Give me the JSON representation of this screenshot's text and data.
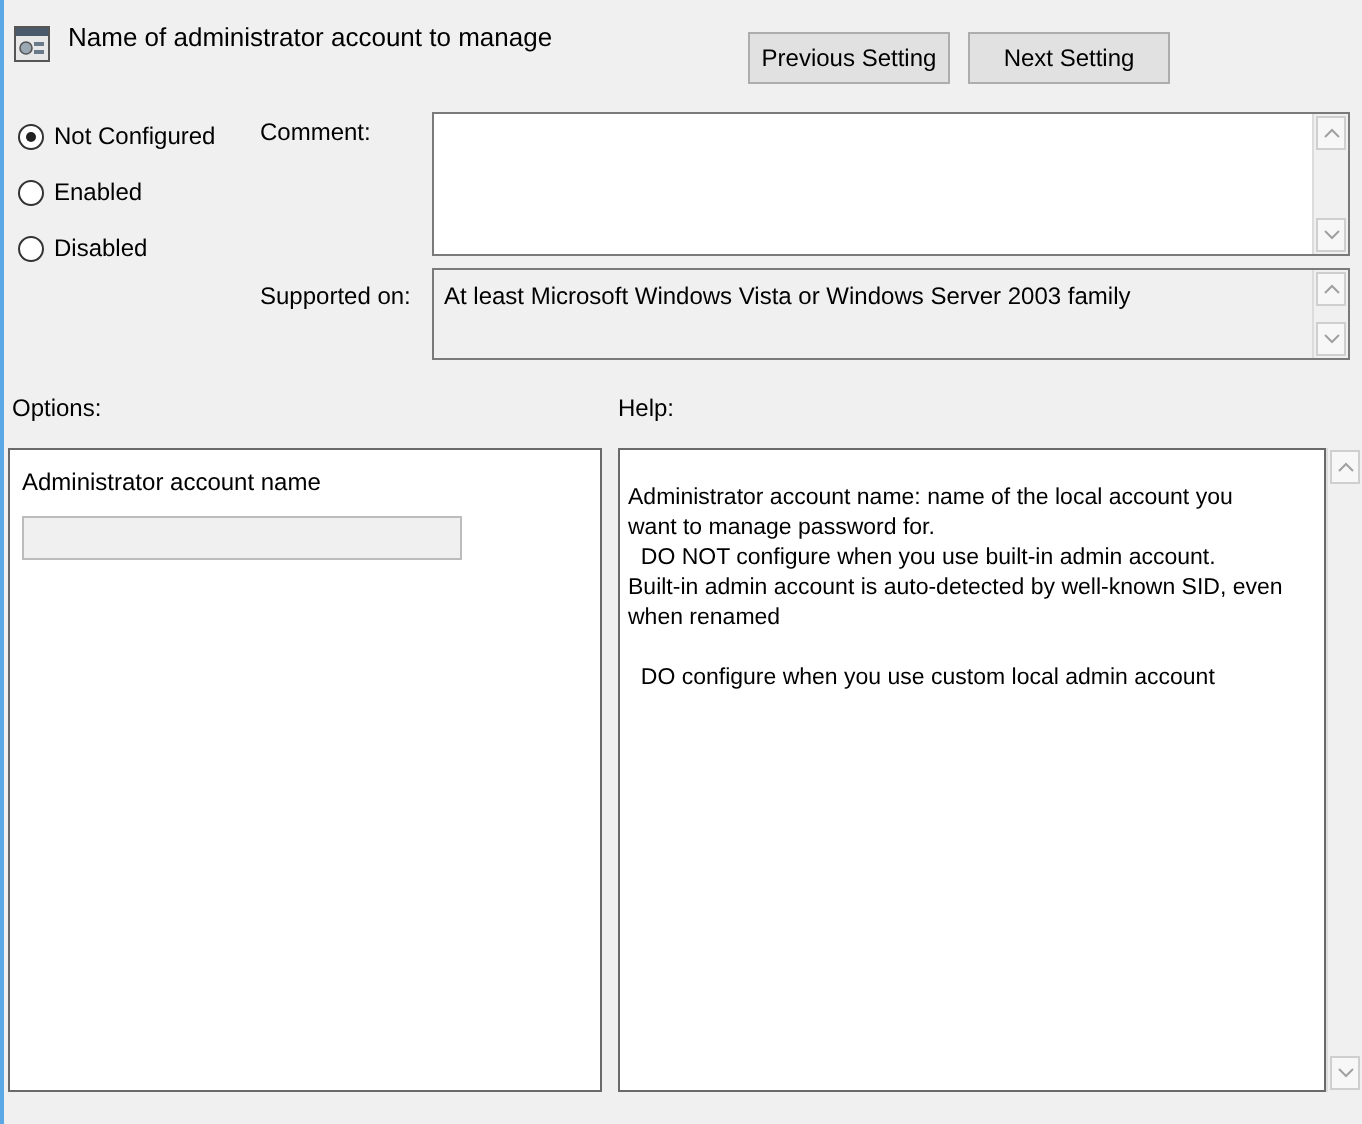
{
  "header": {
    "title": "Name of administrator account to manage"
  },
  "nav_buttons": [
    "Previous Setting",
    "Next Setting"
  ],
  "state_options": [
    {
      "label": "Not Configured",
      "selected": true
    },
    {
      "label": "Enabled",
      "selected": false
    },
    {
      "label": "Disabled",
      "selected": false
    }
  ],
  "comment": {
    "label": "Comment:"
  },
  "supported_on": {
    "label": "Supported on:",
    "value": "At least Microsoft Windows Vista or Windows Server 2003 family"
  },
  "options": {
    "label": "Options:",
    "field_label": "Administrator account name",
    "field_disabled": true
  },
  "help": {
    "label": "Help:",
    "paragraphs": [
      [
        "Administrator account name: name of the local account you",
        "want to manage password for.",
        "  DO NOT configure when you use built-in admin account.",
        "Built-in admin account is auto-detected by well-known SID, even",
        "when renamed"
      ],
      [
        "  DO configure when you use custom local admin account"
      ]
    ]
  }
}
